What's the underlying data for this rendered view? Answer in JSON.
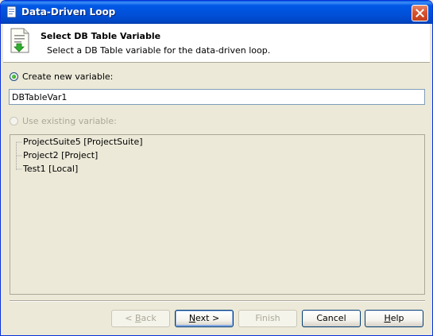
{
  "window": {
    "title": "Data-Driven Loop"
  },
  "header": {
    "title": "Select DB Table Variable",
    "subtitle": "Select a DB Table variable for the data-driven loop."
  },
  "options": {
    "create_new_label": "Create new variable:",
    "create_new_selected": true,
    "new_variable_value": "DBTableVar1",
    "use_existing_label": "Use existing variable:",
    "use_existing_enabled": false
  },
  "tree": {
    "items": [
      {
        "label": "ProjectSuite5 [ProjectSuite]"
      },
      {
        "label": "Project2 [Project]"
      },
      {
        "label": "Test1 [Local]"
      }
    ]
  },
  "buttons": {
    "back": {
      "prefix": "< ",
      "mnemonic": "B",
      "rest": "ack"
    },
    "next": {
      "mnemonic": "N",
      "rest": "ext >"
    },
    "finish": {
      "label": "Finish"
    },
    "cancel": {
      "label": "Cancel"
    },
    "help": {
      "mnemonic": "H",
      "rest": "elp"
    }
  },
  "colors": {
    "titlebar": "#0058e6",
    "close_button": "#d8532f",
    "dialog_background": "#ece9d8",
    "radio_dot": "#21a121"
  }
}
